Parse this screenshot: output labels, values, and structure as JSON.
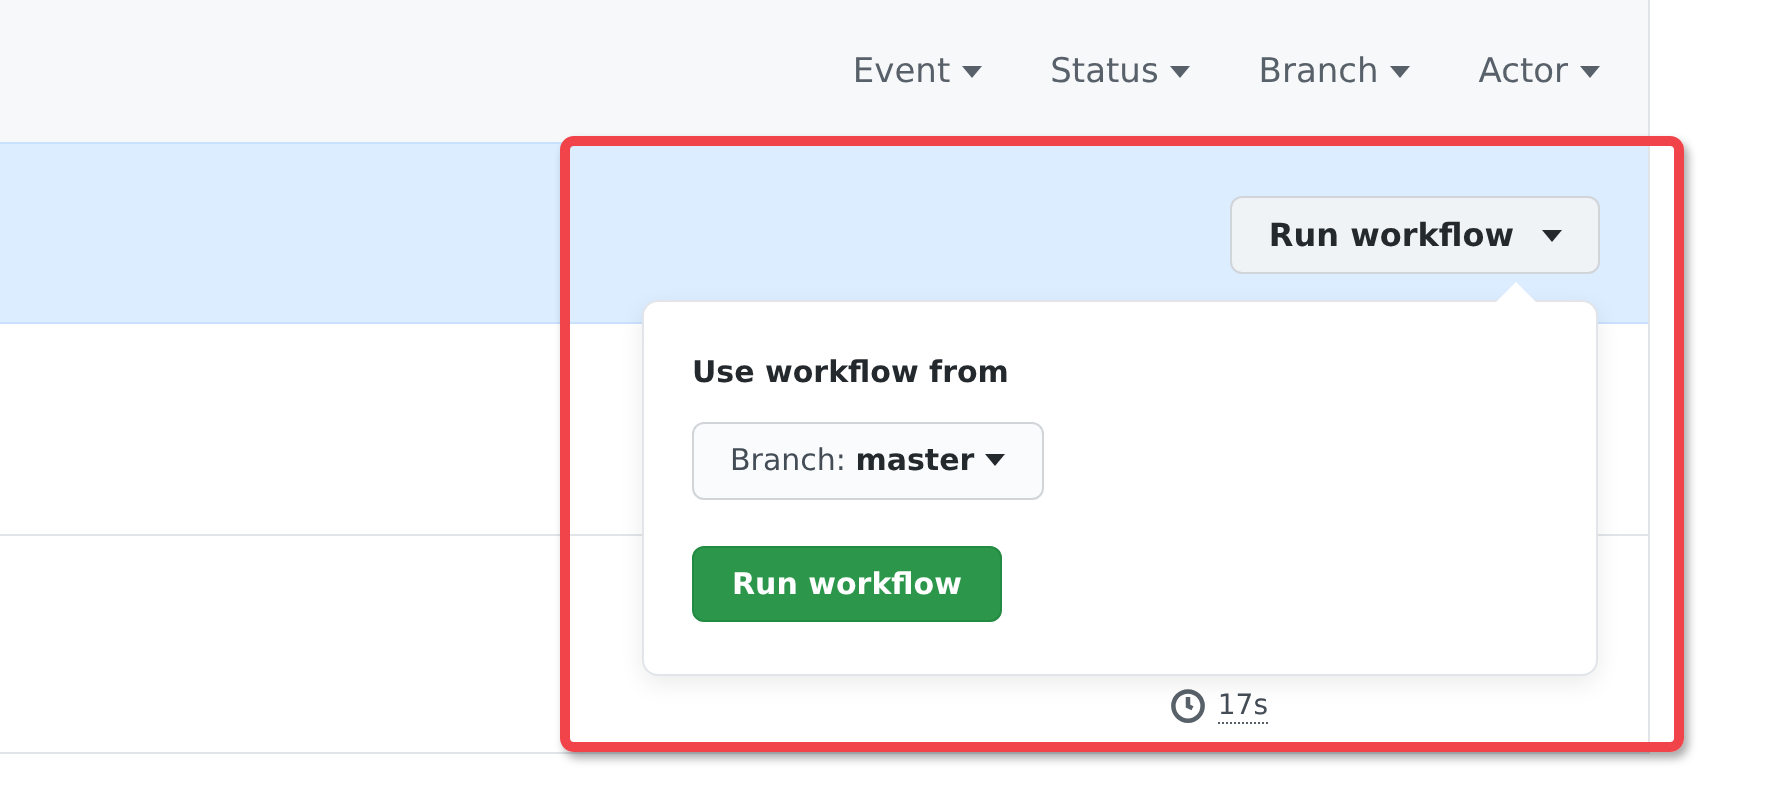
{
  "filters": [
    {
      "label": "Event"
    },
    {
      "label": "Status"
    },
    {
      "label": "Branch"
    },
    {
      "label": "Actor"
    }
  ],
  "run_workflow_button": {
    "label": "Run workflow"
  },
  "popover": {
    "heading": "Use workflow from",
    "branch_select": {
      "label": "Branch:",
      "value": "master"
    },
    "submit": "Run workflow"
  },
  "run_duration": "17s"
}
